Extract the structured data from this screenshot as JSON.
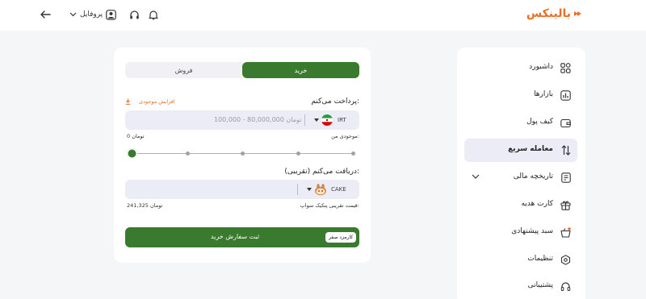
{
  "header": {
    "logo_text": "بالینکس",
    "profile_label": "پروفایل",
    "brand_color": "#e8702a"
  },
  "trade": {
    "tabs": {
      "buy": "خرید",
      "sell": "فروش"
    },
    "pay_label": "پرداخت می‌کنم:",
    "increase_balance": "افزایش موجودی",
    "pay_placeholder": "100,000 - 80,000,000 تومان",
    "pay_currency": "IRT",
    "my_balance_label": "موجودی من:",
    "my_balance_value": "0 تومان",
    "receive_label": "دریافت می‌کنم (تقریبی):",
    "receive_currency": "CAKE",
    "price_label": "قیمت تقریبی پنکیک سواپ:",
    "price_value": "241,325 تومان",
    "submit_label": "ثبت سفارش خرید",
    "fee_badge": "کارمزد صفر",
    "slider_percent": 0,
    "accent_color": "#3a7a2e"
  },
  "sidebar": {
    "items": [
      {
        "label": "داشبورد",
        "icon": "dashboard-icon"
      },
      {
        "label": "بازارها",
        "icon": "markets-icon"
      },
      {
        "label": "کیف پول",
        "icon": "wallet-icon"
      },
      {
        "label": "معامله سریع",
        "icon": "swap-icon",
        "active": true
      },
      {
        "label": "تاریخچه مالی",
        "icon": "history-icon"
      },
      {
        "label": "کارت هدیه",
        "icon": "gift-icon"
      },
      {
        "label": "سبد پیشنهادی",
        "icon": "basket-icon"
      },
      {
        "label": "تنظیمات",
        "icon": "gear-icon"
      },
      {
        "label": "پشتیبانی",
        "icon": "headset-icon"
      }
    ]
  }
}
